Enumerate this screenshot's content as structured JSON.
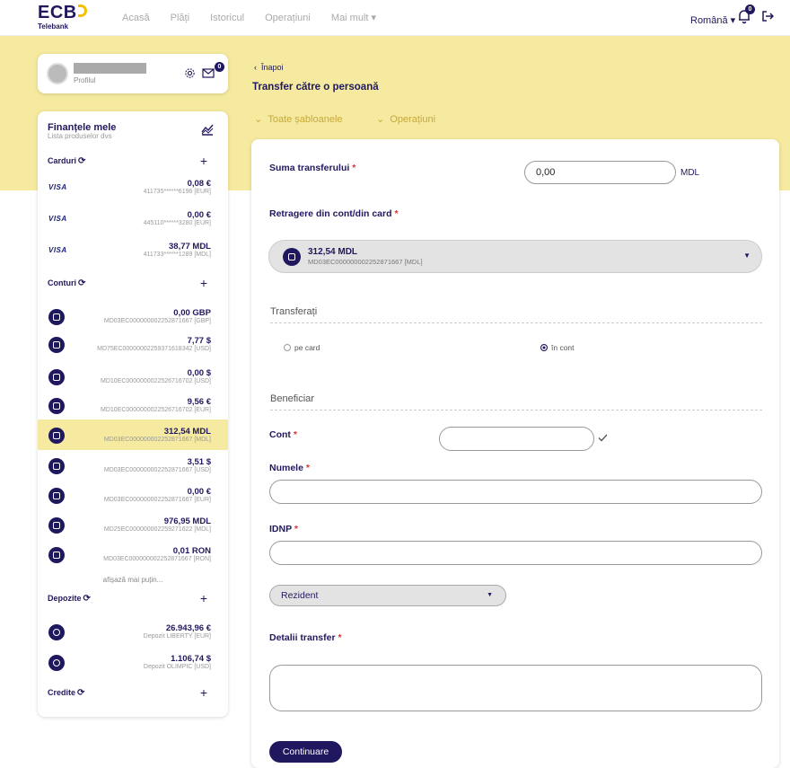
{
  "app": {
    "logo_text": "ECB",
    "logo_sub": "Telebank"
  },
  "nav": {
    "items": [
      "Acasă",
      "Plăți",
      "Istoricul",
      "Operațiuni",
      "Mai mult ▾"
    ],
    "language": "Română ▾",
    "notifications_count": "0"
  },
  "profile": {
    "label": "Profilul",
    "messages_count": "0"
  },
  "finances": {
    "title": "Finanțele mele",
    "subtitle": "Lista produselor dvs",
    "cards_title": "Carduri",
    "cards": [
      {
        "brand": "VISA",
        "amount": "0,08 €",
        "number": "411735******6196 [EUR]"
      },
      {
        "brand": "VISA",
        "amount": "0,00 €",
        "number": "445110******3280 [EUR]"
      },
      {
        "brand": "VISA",
        "amount": "38,77 MDL",
        "number": "411733******1289 [MDL]"
      }
    ],
    "accounts_title": "Conturi",
    "accounts": [
      {
        "amount": "0,00 GBP",
        "number": "MD03EC000000002252871667 [GBP]",
        "selected": false
      },
      {
        "amount": "7,77 $",
        "number": "MD75EC000000022593716183​42 [USD]",
        "selected": false
      },
      {
        "amount": "0,00 $",
        "number": "MD10EC000000002252671670​2 [USD]",
        "selected": false
      },
      {
        "amount": "9,56 €",
        "number": "MD10EC000000002252671670​2 [EUR]",
        "selected": false
      },
      {
        "amount": "312,54 MDL",
        "number": "MD03EC000000002252871667 [MDL]",
        "selected": true
      },
      {
        "amount": "3,51 $",
        "number": "MD03EC000000002252871667 [USD]",
        "selected": false
      },
      {
        "amount": "0,00 €",
        "number": "MD03EC000000002252871667 [EUR]",
        "selected": false
      },
      {
        "amount": "976,95 MDL",
        "number": "MD25EC000000002259271622 [MDL]",
        "selected": false
      },
      {
        "amount": "0,01 RON",
        "number": "MD03EC000000002252871667 [RON]",
        "selected": false
      }
    ],
    "show_less": "afișază mai puțin...",
    "deposits_title": "Depozite",
    "deposits": [
      {
        "amount": "26.943,96 €",
        "name": "Depozit LIBERTY [EUR]"
      },
      {
        "amount": "1.106,74 $",
        "name": "Depozit OLIMPIC [USD]"
      }
    ],
    "credits_title": "Credite"
  },
  "page": {
    "back": "Înapoi",
    "title": "Transfer către o persoană",
    "templates": "Toate șabloanele",
    "operations": "Operațiuni"
  },
  "form": {
    "amount_label": "Suma transferului",
    "amount_value": "0,00",
    "amount_unit": "MDL",
    "source_label": "Retragere din cont/din card",
    "source_amount": "312,54 MDL",
    "source_account": "MD03EC000000002252871667 [MDL]",
    "transfer_section": "Transferați",
    "radio_card": "pe card",
    "radio_account": "în cont",
    "beneficiary_section": "Beneficiar",
    "account_label": "Cont",
    "name_label": "Numele",
    "idnp_label": "IDNP",
    "resident": "Rezident",
    "details_label": "Detalii transfer",
    "continue": "Continuare",
    "required_mark": "*"
  }
}
